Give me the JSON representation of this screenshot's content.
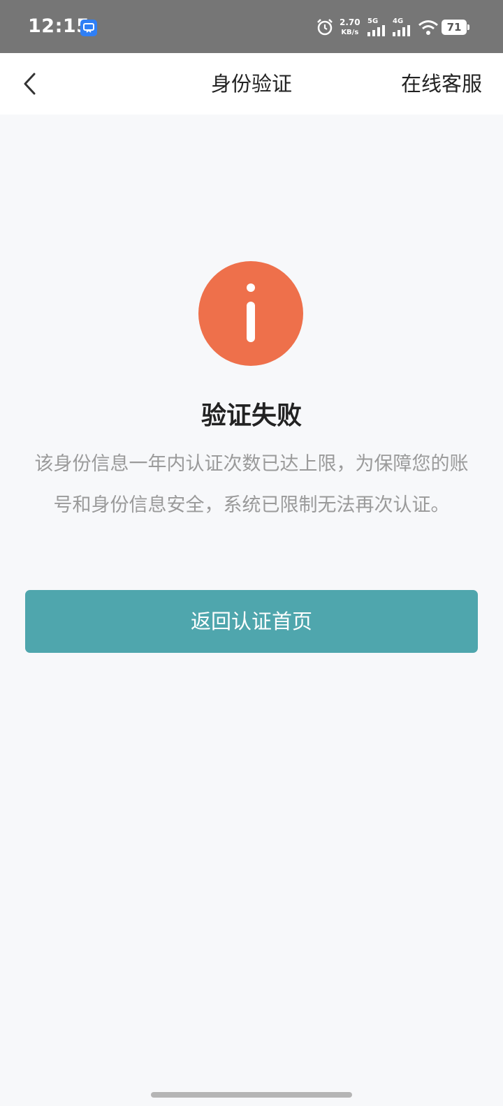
{
  "status_bar": {
    "time": "12:15",
    "net_speed_value": "2.70",
    "net_speed_unit": "KB/s",
    "signal_1_label": "5G",
    "signal_2_label": "4G",
    "battery": "71"
  },
  "header": {
    "title": "身份验证",
    "service_label": "在线客服"
  },
  "result": {
    "title": "验证失败",
    "description": "该身份信息一年内认证次数已达上限，为保障您的账号和身份信息安全，系统已限制无法再次认证。",
    "icon_color": "#ee704b"
  },
  "actions": {
    "return_label": "返回认证首页"
  },
  "colors": {
    "status_bar": "#767676",
    "accent": "#4fa6ad",
    "background": "#f7f8fa"
  }
}
